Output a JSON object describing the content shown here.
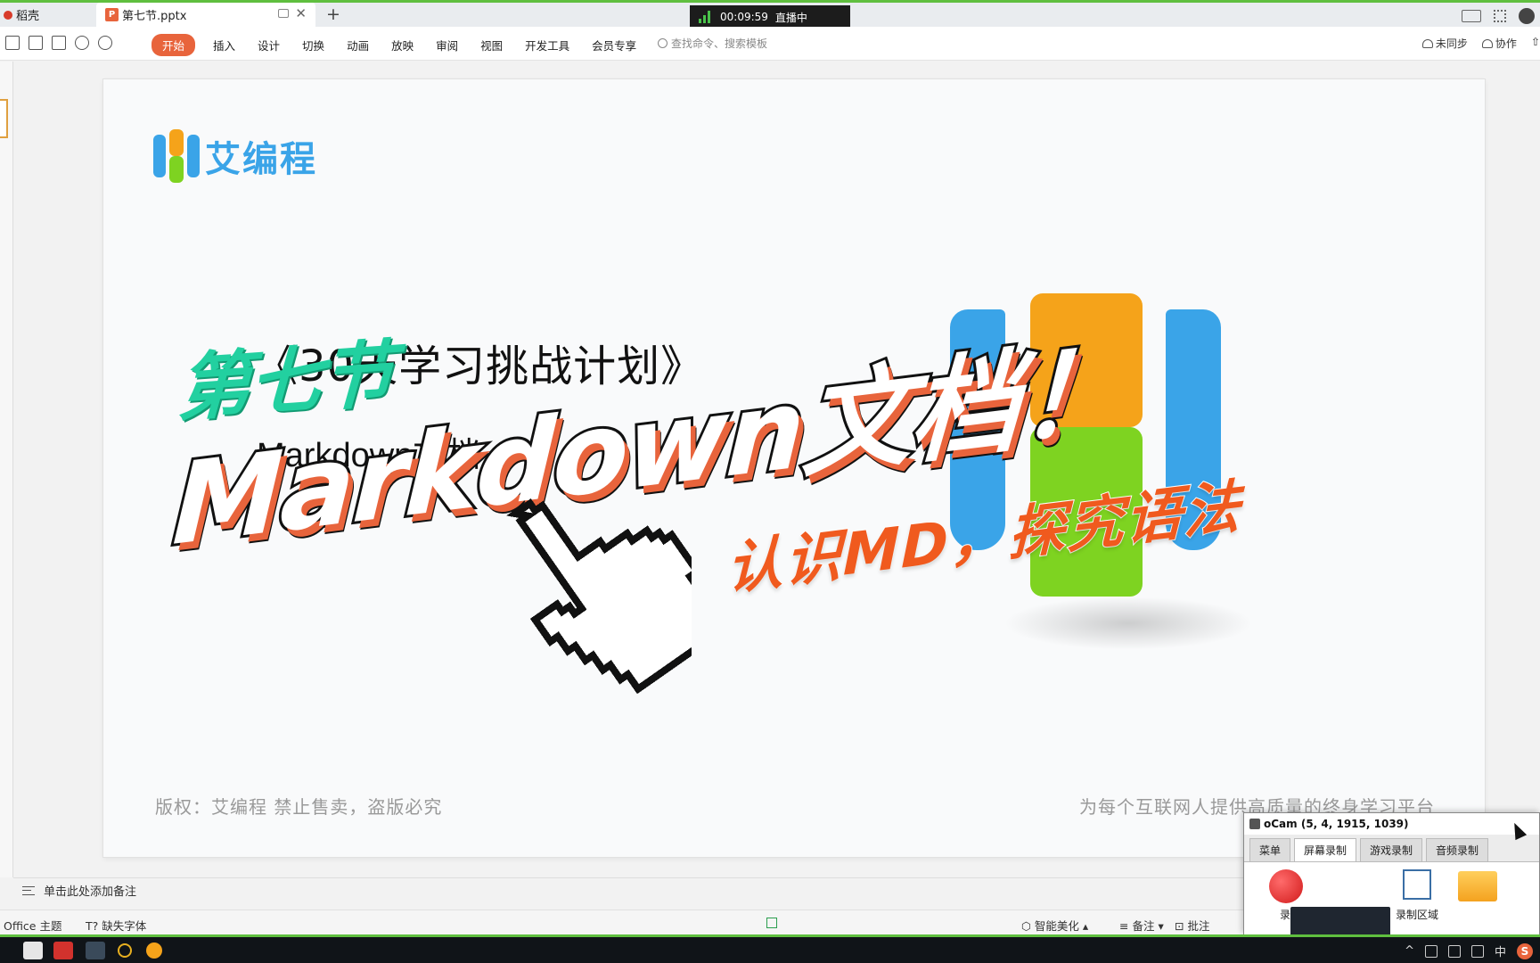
{
  "tabs": {
    "home": "稻壳",
    "doc": "第七节.pptx"
  },
  "live": {
    "time": "00:09:59",
    "status": "直播中"
  },
  "ribbon": {
    "menu": [
      "开始",
      "插入",
      "设计",
      "切换",
      "动画",
      "放映",
      "审阅",
      "视图",
      "开发工具",
      "会员专享"
    ],
    "search_placeholder": "查找命令、搜索模板",
    "sync": "未同步",
    "collab": "协作"
  },
  "slide": {
    "logo_text": "艾编程",
    "chapter": "第七节",
    "subtitle": "《30天学习挑战计划》",
    "md_subtitle": "Markdown文档",
    "big_title": "Markdown文档！",
    "tagline": "认识MD，探究语法",
    "copyright": "版权：艾编程   禁止售卖，盗版必究",
    "slogan": "为每个互联网人提供高质量的终身学习平台",
    "colors": {
      "blue": "#3aa4e8",
      "orange": "#f5a31a",
      "green": "#7ed321",
      "accent": "#e8643c",
      "teal": "#22d0a0"
    }
  },
  "notes": {
    "placeholder": "单击此处添加备注"
  },
  "status": {
    "theme": "Office 主题",
    "missing_font": "缺失字体",
    "beautify": "智能美化",
    "notes": "备注",
    "comments": "批注"
  },
  "ocam": {
    "title": "oCam (5, 4, 1915, 1039)",
    "tabs": [
      "菜单",
      "屏幕录制",
      "游戏录制",
      "音频录制"
    ],
    "record": "录制",
    "region": "录制区域"
  },
  "taskbar": {
    "ime": "中"
  }
}
